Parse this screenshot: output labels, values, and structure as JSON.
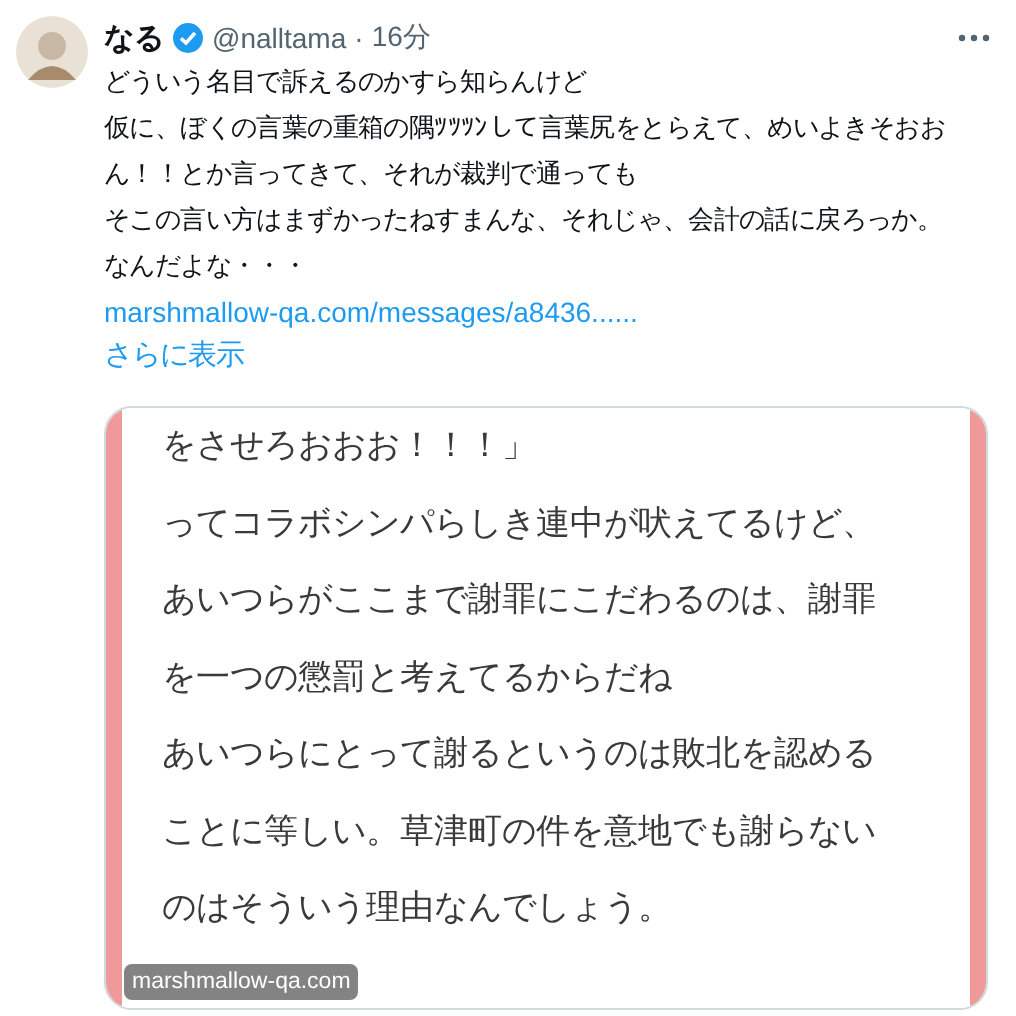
{
  "tweet": {
    "name": "なる",
    "verified": true,
    "handle": "@nalltama",
    "separator": "·",
    "time": "16分",
    "lines": [
      "どういう名目で訴えるのかすら知らんけど",
      "仮に、ぼくの言葉の重箱の隅ﾂﾂﾂﾝして言葉尻をとらえて、めいよきそおお",
      "ん！！とか言ってきて、それが裁判で通っても",
      "そこの言い方はまずかったねすまんな、それじゃ、会計の話に戻ろっか。",
      "なんだよな・・・"
    ],
    "link": "marshmallow-qa.com/messages/a8436......",
    "show_more": "さらに表示"
  },
  "card": {
    "lines": [
      "をさせろおおお！！！」",
      "ってコラボシンパらしき連中が吠えてるけど、",
      "あいつらがここまで謝罪にこだわるのは、謝罪",
      "を一つの懲罰と考えてるからだね",
      "あいつらにとって謝るというのは敗北を認める",
      "ことに等しい。草津町の件を意地でも謝らない",
      "のはそういう理由なんでしょう。"
    ],
    "source": "marshmallow-qa.com"
  }
}
